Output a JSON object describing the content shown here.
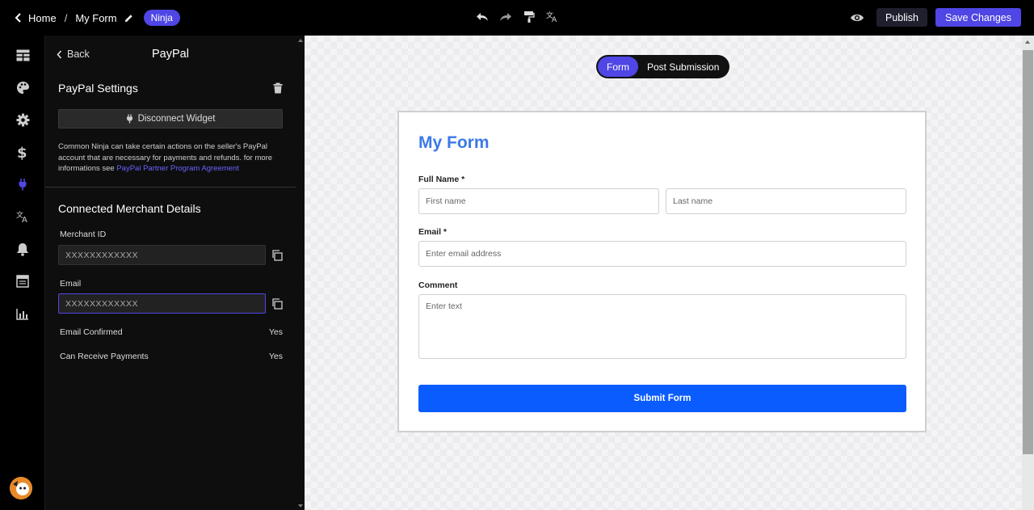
{
  "topbar": {
    "home_label": "Home",
    "separator": "/",
    "form_name": "My Form",
    "badge": "Ninja",
    "publish_label": "Publish",
    "save_label": "Save Changes"
  },
  "panel": {
    "back_label": "Back",
    "title": "PayPal",
    "settings_title": "PayPal Settings",
    "disconnect_label": "Disconnect Widget",
    "description": "Common Ninja can take certain actions on the seller's PayPal account that are necessary for payments and refunds. for more informations see ",
    "agreement_link": "PayPal Partner Program Agreement",
    "merchant_section_title": "Connected Merchant Details",
    "merchant_id_label": "Merchant ID",
    "merchant_id_value": "XXXXXXXXXXXX",
    "email_label": "Email",
    "email_value": "XXXXXXXXXXXX",
    "email_confirmed_label": "Email Confirmed",
    "email_confirmed_value": "Yes",
    "can_receive_label": "Can Receive Payments",
    "can_receive_value": "Yes"
  },
  "canvas": {
    "tabs": [
      {
        "label": "Form",
        "active": true
      },
      {
        "label": "Post Submission",
        "active": false
      }
    ],
    "form": {
      "title": "My Form",
      "full_name_label": "Full Name *",
      "first_name_placeholder": "First name",
      "last_name_placeholder": "Last name",
      "email_label": "Email *",
      "email_placeholder": "Enter email address",
      "comment_label": "Comment",
      "comment_placeholder": "Enter text",
      "submit_label": "Submit Form"
    }
  },
  "colors": {
    "accent": "#4f46e5",
    "form_title": "#3b7ae8",
    "submit": "#0b5cff",
    "link": "#6a62ff"
  },
  "icons": {
    "rail": [
      "layout-icon",
      "palette-icon",
      "gear-icon",
      "dollar-icon",
      "plug-icon",
      "translate-icon",
      "bell-icon",
      "table-icon",
      "chart-icon"
    ],
    "toolbar": [
      "undo-icon",
      "redo-icon",
      "paint-roller-icon",
      "translate-icon"
    ]
  }
}
